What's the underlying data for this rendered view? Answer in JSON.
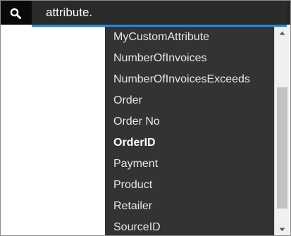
{
  "search": {
    "value": "attribute.",
    "icon": "search-icon"
  },
  "colors": {
    "search_bar": "#262626",
    "icon_box": "#0a0a0a",
    "underline": "#1f86e6",
    "dropdown": "#333333",
    "item_text": "#e6e6e6"
  },
  "suggestions": [
    {
      "label": "MyCustomAttribute",
      "bold": false
    },
    {
      "label": "NumberOfInvoices",
      "bold": false
    },
    {
      "label": "NumberOfInvoicesExceeds",
      "bold": false
    },
    {
      "label": "Order",
      "bold": false
    },
    {
      "label": "Order No",
      "bold": false
    },
    {
      "label": "OrderID",
      "bold": true
    },
    {
      "label": "Payment",
      "bold": false
    },
    {
      "label": "Product",
      "bold": false
    },
    {
      "label": "Retailer",
      "bold": false
    },
    {
      "label": "SourceID",
      "bold": false
    }
  ],
  "scrollbar": {
    "up_icon": "scroll-up-icon",
    "down_icon": "scroll-down-icon"
  }
}
